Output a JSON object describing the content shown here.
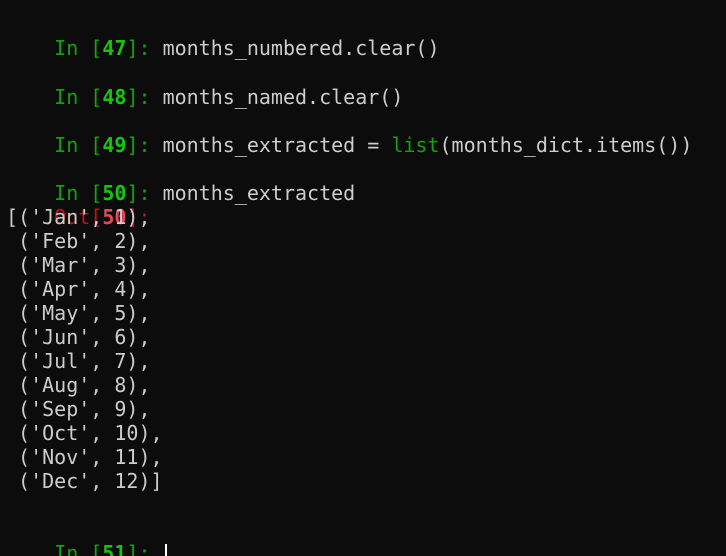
{
  "cells": [
    {
      "prompt_in": "In [",
      "num": "47",
      "close": "]: ",
      "code": "months_numbered.clear()"
    },
    {
      "prompt_in": "In [",
      "num": "48",
      "close": "]: ",
      "code": "months_named.clear()"
    },
    {
      "prompt_in": "In [",
      "num": "49",
      "close": "]: ",
      "code_pre": "months_extracted = ",
      "code_builtin": "list",
      "code_post": "(months_dict.items())"
    },
    {
      "prompt_in": "In [",
      "num": "50",
      "close": "]: ",
      "code": "months_extracted"
    }
  ],
  "output": {
    "label": "Out[",
    "num": "50",
    "close": "]:",
    "lines": [
      "[('Jan', 1),",
      " ('Feb', 2),",
      " ('Mar', 3),",
      " ('Apr', 4),",
      " ('May', 5),",
      " ('Jun', 6),",
      " ('Jul', 7),",
      " ('Aug', 8),",
      " ('Sep', 9),",
      " ('Oct', 10),",
      " ('Nov', 11),",
      " ('Dec', 12)]"
    ]
  },
  "current_prompt": {
    "prompt_in": "In [",
    "num": "51",
    "close": "]: "
  }
}
